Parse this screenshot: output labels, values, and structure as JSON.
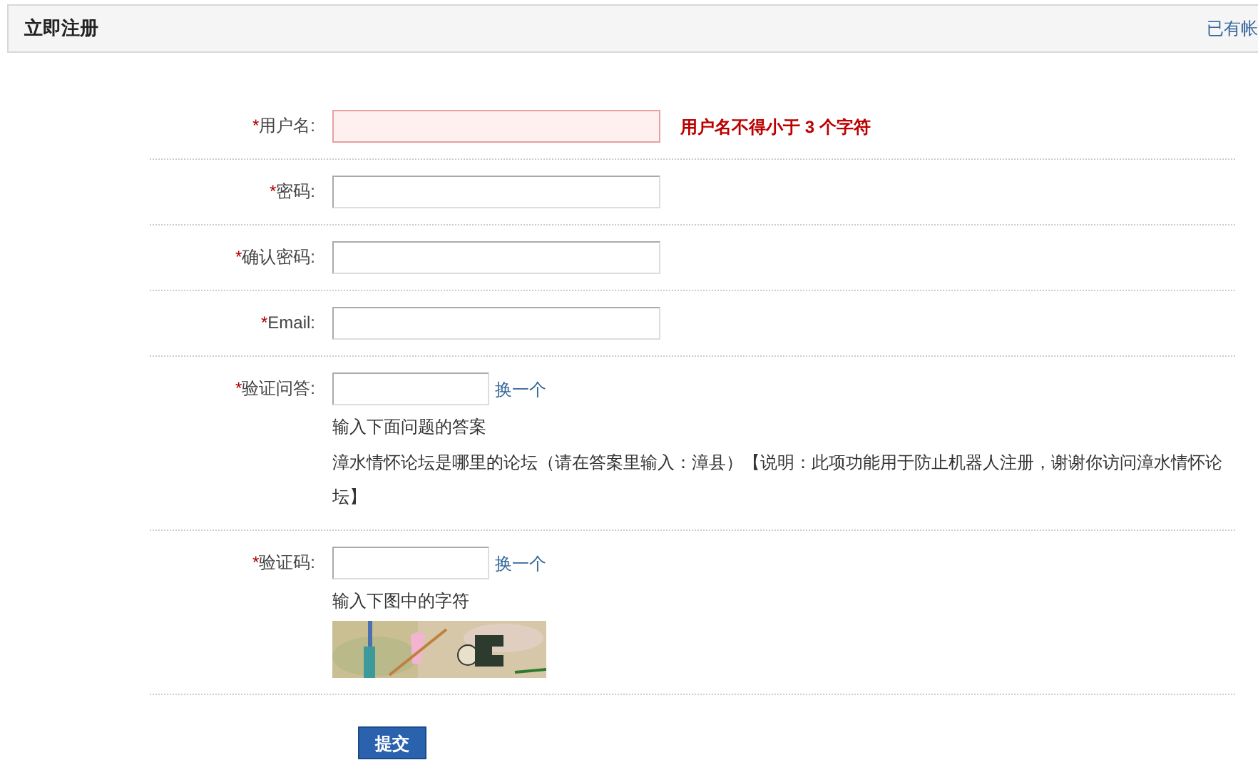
{
  "header": {
    "title": "立即注册",
    "link": "已有帐"
  },
  "fields": [
    {
      "kind": "text",
      "mark": "*",
      "label": "用户名:",
      "invalid": true,
      "error": "用户名不得小于 3 个字符"
    },
    {
      "kind": "text",
      "mark": "*",
      "label": "密码:",
      "invalid": false
    },
    {
      "kind": "text",
      "mark": "*",
      "label": "确认密码:",
      "invalid": false
    },
    {
      "kind": "text",
      "mark": "*",
      "label": "Email:",
      "invalid": false
    },
    {
      "kind": "question",
      "mark": "*",
      "label": "验证问答:",
      "invalid": false,
      "refresh": "换一个",
      "hint": "输入下面问题的答案",
      "question": "漳水情怀论坛是哪里的论坛（请在答案里输入：漳县）【说明：此项功能用于防止机器人注册，谢谢你访问漳水情怀论坛】"
    },
    {
      "kind": "captcha",
      "mark": "*",
      "label": "验证码:",
      "invalid": false,
      "refresh": "换一个",
      "hint": "输入下图中的字符"
    }
  ],
  "submit": "提交"
}
